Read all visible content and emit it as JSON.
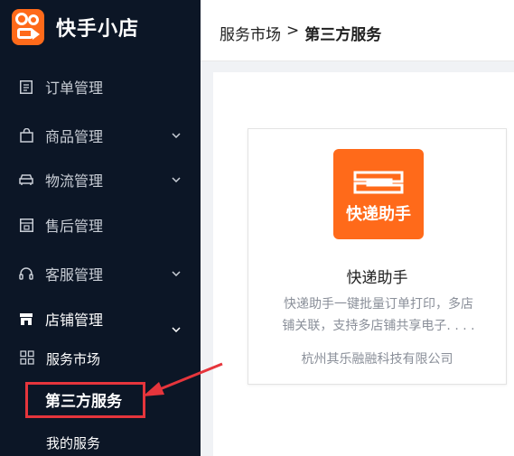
{
  "brand": {
    "name": "快手小店"
  },
  "sidebar": {
    "items": [
      {
        "label": "订单管理",
        "icon": "order-icon"
      },
      {
        "label": "商品管理",
        "icon": "bag-icon"
      },
      {
        "label": "物流管理",
        "icon": "car-icon"
      },
      {
        "label": "售后管理",
        "icon": "aftersale-icon"
      },
      {
        "label": "客服管理",
        "icon": "headset-icon"
      },
      {
        "label": "店铺管理",
        "icon": "shop-icon"
      }
    ],
    "sub": {
      "market": "服务市场",
      "third_party": "第三方服务",
      "my_services": "我的服务"
    }
  },
  "header": {
    "breadcrumb_parent": "服务市场",
    "breadcrumb_sep": ">",
    "breadcrumb_current": "第三方服务"
  },
  "card": {
    "logo_text": "快递助手",
    "name": "快递助手",
    "description_line1": "快递助手一键批量订单打印，多店",
    "description_line2": "铺关联，支持多店铺共享电子. . . .",
    "company": "杭州其乐融融科技有限公司"
  },
  "colors": {
    "sidebar_bg": "#0c1626",
    "brand_orange": "#ff6a1a",
    "highlight_red": "#e6353c"
  }
}
